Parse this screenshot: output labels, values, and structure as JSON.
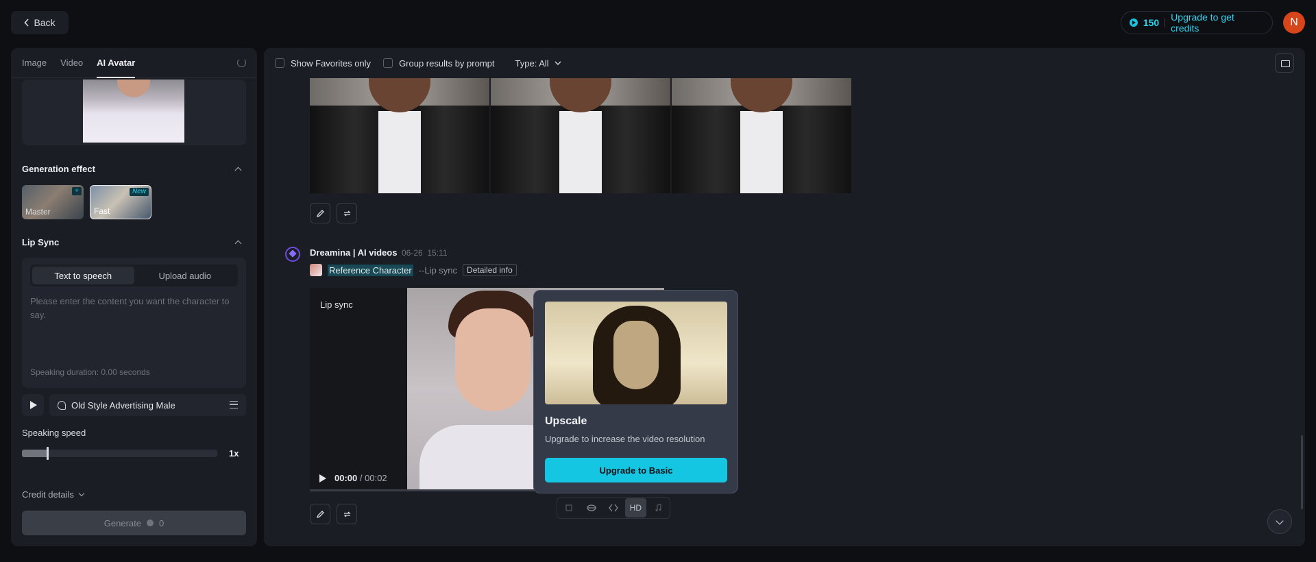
{
  "topbar": {
    "back_label": "Back",
    "credits_value": "150",
    "upgrade_label": "Upgrade to get credits",
    "avatar_initial": "N"
  },
  "left_panel": {
    "tabs": [
      {
        "label": "Image"
      },
      {
        "label": "Video"
      },
      {
        "label": "AI Avatar",
        "active": true
      }
    ],
    "generation_effect": {
      "title": "Generation effect",
      "options": [
        {
          "label": "Master",
          "badge": "+"
        },
        {
          "label": "Fast",
          "badge": "New",
          "selected": true
        }
      ]
    },
    "lip_sync": {
      "title": "Lip Sync",
      "modes": [
        {
          "label": "Text to speech",
          "active": true
        },
        {
          "label": "Upload audio"
        }
      ],
      "placeholder": "Please enter the content you want the character to say.",
      "duration": "Speaking duration: 0.00 seconds",
      "voice": "Old Style Advertising Male"
    },
    "speed": {
      "label": "Speaking speed",
      "value": "1x",
      "level": 0.13
    },
    "credit_details": "Credit details",
    "generate": {
      "label": "Generate",
      "cost": "0"
    }
  },
  "main": {
    "filters": {
      "favorites": "Show Favorites only",
      "group": "Group results by prompt",
      "type": "Type: All"
    },
    "result": {
      "brand": "Dreamina | AI videos",
      "date": "06-26",
      "time": "15:11",
      "reference": "Reference Character",
      "mode": "--Lip sync",
      "detail": "Detailed info"
    },
    "video": {
      "label": "Lip sync",
      "current": "00:00",
      "separator": "/",
      "total": "00:02"
    },
    "upscale": {
      "title": "Upscale",
      "subtitle": "Upgrade to increase the video resolution",
      "button": "Upgrade to Basic"
    },
    "video_tools": {
      "hd_label": "HD"
    }
  },
  "colors": {
    "accent": "#14c6e2",
    "avatar": "#d7451b",
    "brand": "#6e4bdf",
    "background": "#0d0f13",
    "panel": "#1a1d24"
  }
}
